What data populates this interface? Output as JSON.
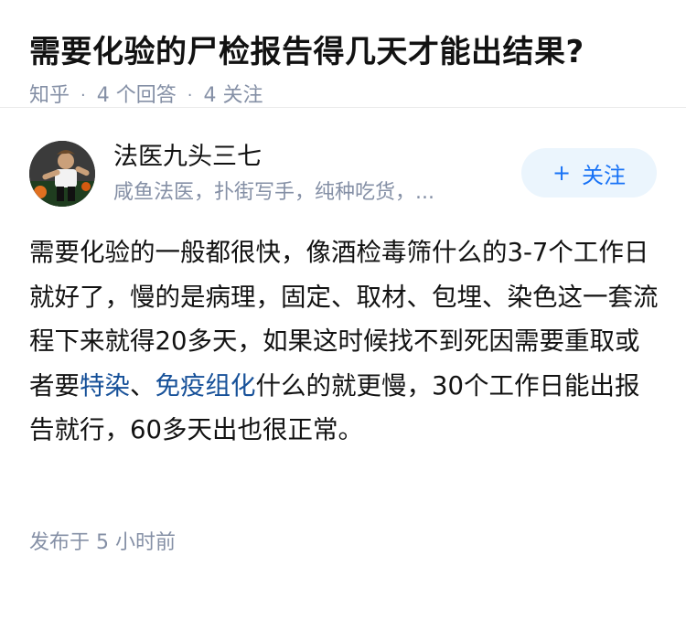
{
  "question": {
    "title": "需要化验的尸检报告得几天才能出结果?",
    "source": "知乎",
    "answer_count": "4 个回答",
    "follow_count": "4 关注"
  },
  "answer": {
    "author": {
      "name": "法医九头三七",
      "bio": "咸鱼法医，扑街写手，纯种吃货，...",
      "follow_label": "关注",
      "follow_icon": "plus-icon"
    },
    "content": {
      "part1": "需要化验的一般都很快，像酒检毒筛什么的3-7个工作日就好了，慢的是病理，固定、取材、包埋、染色这一套流程下来就得20多天，如果这时候找不到死因需要重取或者要",
      "link1": "特染",
      "sep": "、",
      "link2": "免疫组化",
      "part2": "什么的就更慢，30个工作日能出报告就行，60多天出也很正常。"
    },
    "time": "发布于  5 小时前"
  },
  "colors": {
    "link": "#175199",
    "meta": "#8590a6",
    "follow_bg": "#ebf5fd",
    "follow_text": "#1772f6"
  }
}
